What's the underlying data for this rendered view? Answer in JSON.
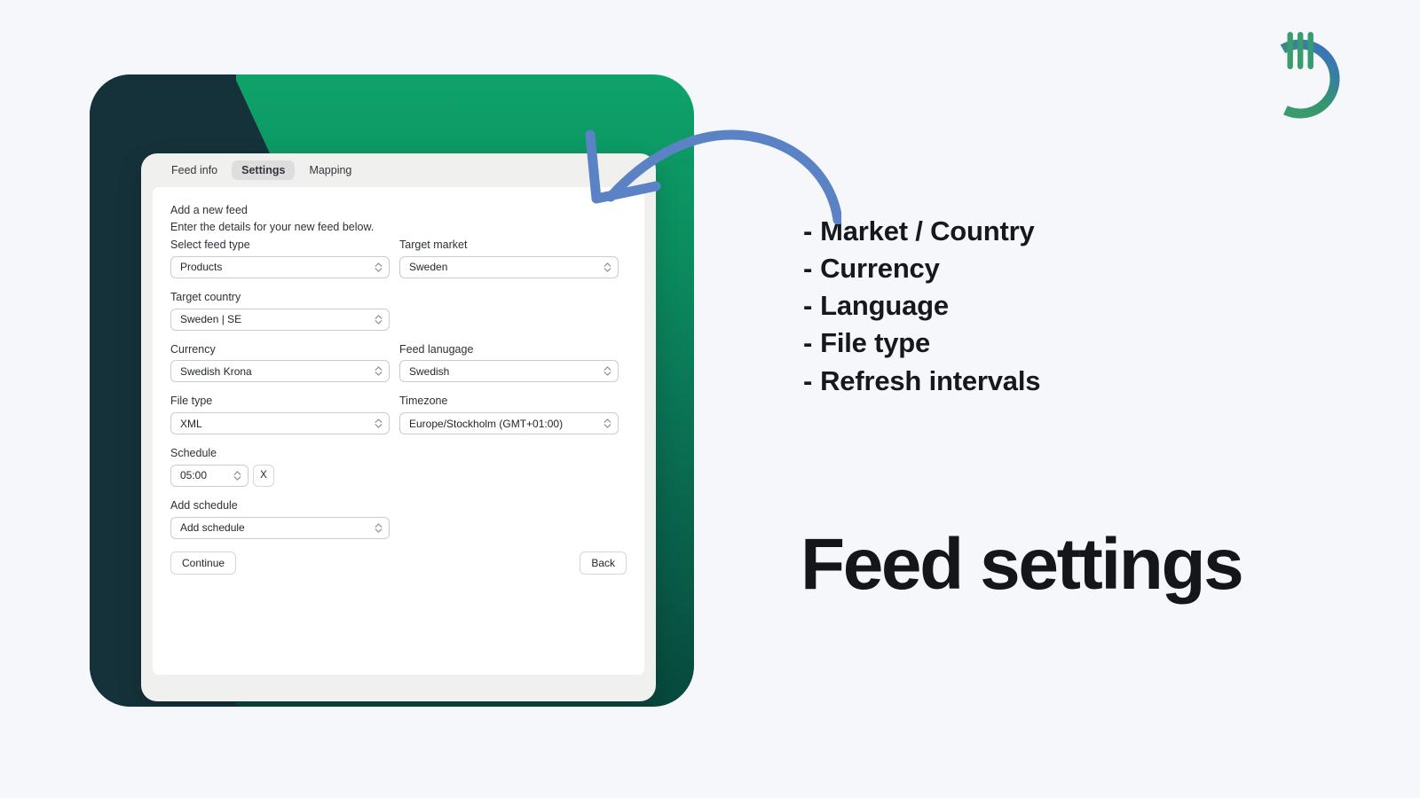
{
  "colors": {
    "page_background": "#f5f7fb",
    "card_green_top": "#0ea36a",
    "card_green_bottom": "#08483d",
    "card_navy": "#15323a",
    "arrow_blue": "#5b82c4",
    "logo_green": "#3a9d6e",
    "logo_blue": "#3a6fc4",
    "active_tab_background": "#dedede",
    "text_dark": "#17181c"
  },
  "logo": {
    "icon_name": "power-button-logo"
  },
  "app_panel": {
    "tabs": [
      {
        "label": "Feed info",
        "active": false,
        "name": "tab-feed-info"
      },
      {
        "label": "Settings",
        "active": true,
        "name": "tab-settings"
      },
      {
        "label": "Mapping",
        "active": false,
        "name": "tab-mapping"
      }
    ],
    "form": {
      "heading": "Add a new feed",
      "subheading": "Enter the details for your new feed below.",
      "fields": [
        {
          "label": "Select feed type",
          "value": "Products",
          "icon": "stepper-updown-icon"
        },
        {
          "label": "Target market",
          "value": "Sweden",
          "icon": "stepper-updown-icon"
        },
        {
          "label": "Target country",
          "value": "Sweden | SE",
          "icon": "stepper-updown-icon"
        },
        {
          "label": "Currency",
          "value": "Swedish Krona",
          "icon": "stepper-updown-icon"
        },
        {
          "label": "Feed lanugage",
          "value": "Swedish",
          "icon": "stepper-updown-icon"
        },
        {
          "label": "File type",
          "value": "XML",
          "icon": "stepper-updown-icon"
        },
        {
          "label": "Timezone",
          "value": "Europe/Stockholm (GMT+01:00)",
          "icon": "stepper-updown-icon"
        }
      ],
      "schedule": {
        "label": "Schedule",
        "value": "05:00",
        "remove_label": "X"
      },
      "add_schedule": {
        "label": "Add schedule",
        "value": "Add schedule"
      },
      "continue_label": "Continue",
      "back_label": "Back"
    }
  },
  "annotation": {
    "arrow_name": "curved-arrow-pointing-to-settings-tab",
    "feature_list": [
      "Market / Country",
      "Currency",
      "Language",
      "File type",
      "Refresh intervals"
    ],
    "list_bullet": "-",
    "headline": "Feed settings"
  }
}
